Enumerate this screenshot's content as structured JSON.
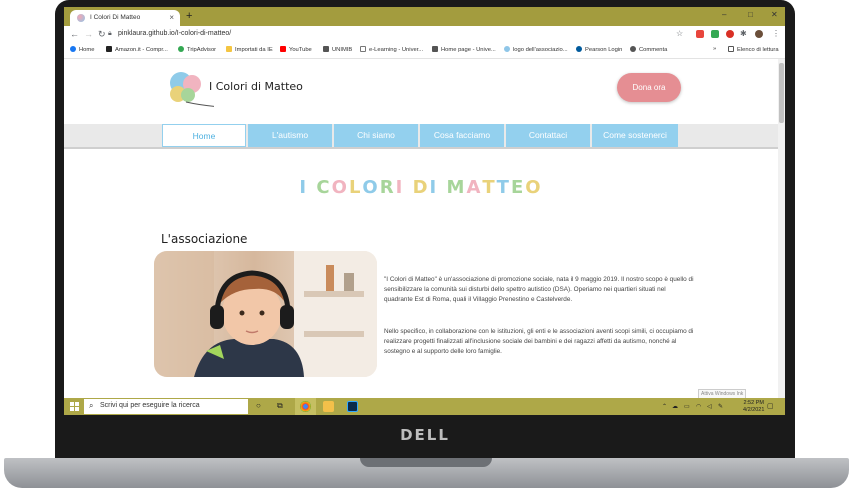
{
  "browser": {
    "tab_title": "I Colori Di Matteo",
    "new_tab_symbol": "+",
    "tab_close_symbol": "×",
    "url": "pinklaura.github.io/I-colori-di-matteo/",
    "window_controls": {
      "minimize": "–",
      "maximize": "□",
      "close": "✕"
    },
    "bookmarks": [
      {
        "label": "Home",
        "icon": "facebook-icon",
        "color": "#1877f2"
      },
      {
        "label": "Amazon.it - Compr...",
        "icon": "amazon-icon",
        "color": "#222222"
      },
      {
        "label": "TripAdvisor",
        "icon": "tripadvisor-icon",
        "color": "#34a853"
      },
      {
        "label": "Importati da IE",
        "icon": "folder-icon",
        "color": "#f4c542"
      },
      {
        "label": "YouTube",
        "icon": "youtube-icon",
        "color": "#ff0000"
      },
      {
        "label": "UNIMIB",
        "icon": "unimib-icon",
        "color": "#555555"
      },
      {
        "label": "e-Learning - Univer...",
        "icon": "doc-icon",
        "color": "#777777"
      },
      {
        "label": "Home page - Unive...",
        "icon": "image-icon",
        "color": "#555555"
      },
      {
        "label": "logo dell'associazio...",
        "icon": "logo-icon",
        "color": "#8fc6e8"
      },
      {
        "label": "Pearson Login",
        "icon": "pearson-icon",
        "color": "#005a9c"
      },
      {
        "label": "Commenta",
        "icon": "globe-icon",
        "color": "#555555"
      }
    ],
    "bookmarks_more": "»",
    "reading_list": "Elenco di lettura"
  },
  "site": {
    "logo_text": "I Colori di Matteo",
    "donate_label": "Dona ora",
    "menu": [
      "Home",
      "L'autismo",
      "Chi siamo",
      "Cosa facciamo",
      "Contattaci",
      "Come sostenerci"
    ],
    "active_menu_index": 0,
    "title_letters": [
      {
        "ch": "I",
        "color": "#8fcbe9"
      },
      {
        "ch": " ",
        "color": "#ffffff"
      },
      {
        "ch": "C",
        "color": "#a7d59a"
      },
      {
        "ch": "O",
        "color": "#f1b4c0"
      },
      {
        "ch": "L",
        "color": "#e9d27a"
      },
      {
        "ch": "O",
        "color": "#8fcbe9"
      },
      {
        "ch": "R",
        "color": "#a7d59a"
      },
      {
        "ch": "I",
        "color": "#f1b4c0"
      },
      {
        "ch": " ",
        "color": "#ffffff"
      },
      {
        "ch": "D",
        "color": "#e9d27a"
      },
      {
        "ch": "I",
        "color": "#8fcbe9"
      },
      {
        "ch": " ",
        "color": "#ffffff"
      },
      {
        "ch": "M",
        "color": "#a7d59a"
      },
      {
        "ch": "A",
        "color": "#f1b4c0"
      },
      {
        "ch": "T",
        "color": "#e9d27a"
      },
      {
        "ch": "T",
        "color": "#8fcbe9"
      },
      {
        "ch": "E",
        "color": "#a7d59a"
      },
      {
        "ch": "O",
        "color": "#e9d27a"
      }
    ],
    "section_heading": "L'associazione",
    "paragraph_1": "\"I Colori di Matteo\" è un'associazione di promozione sociale, nata il 9 maggio 2019. Il nostro scopo è quello di sensibilizzare la comunità sui disturbi dello spettro autistico (DSA). Operiamo nei quartieri situati nel quadrante Est di Roma, quali il Villaggio Prenestino e Castelverde.",
    "paragraph_2": "Nello specifico, in collaborazione con le istituzioni, gli enti e le associazioni aventi scopi simili, ci occupiamo di realizzare progetti finalizzati all'inclusione sociale dei bambini e dei ragazzi affetti da autismo, nonché al sostegno e al supporto delle loro famiglie.",
    "watermark": "Attiva Windows Ink"
  },
  "taskbar": {
    "search_placeholder": "Scrivi qui per eseguire la ricerca",
    "time": "2:52 PM",
    "date": "4/2/2021"
  },
  "device": {
    "brand": "DELL"
  }
}
